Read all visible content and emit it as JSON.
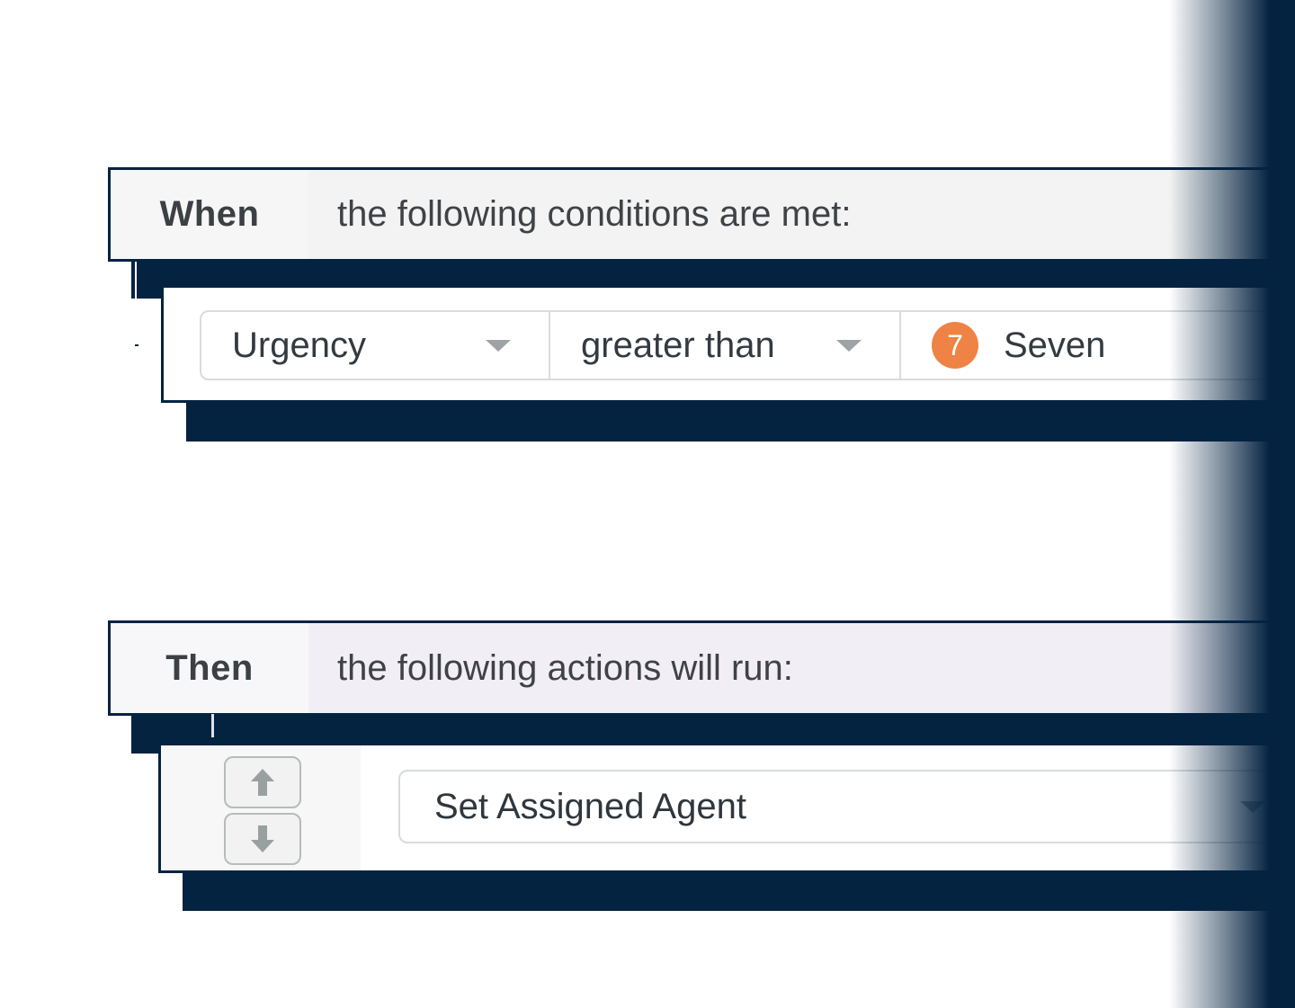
{
  "conditions": {
    "keyword": "When",
    "description": "the following conditions are met:",
    "row": {
      "field": "Urgency",
      "operator": "greater than",
      "value_badge": "7",
      "value_label": "Seven"
    }
  },
  "actions": {
    "keyword": "Then",
    "description": "the following actions will run:",
    "row": {
      "action": "Set Assigned Agent"
    }
  },
  "colors": {
    "navy": "#042341",
    "badge_orange": "#ee8345",
    "header_bg": "#f2f3f2",
    "then_header_bg": "#f1eff5"
  },
  "icons": [
    "chevron-down-icon",
    "arrow-up-icon",
    "arrow-down-icon"
  ]
}
